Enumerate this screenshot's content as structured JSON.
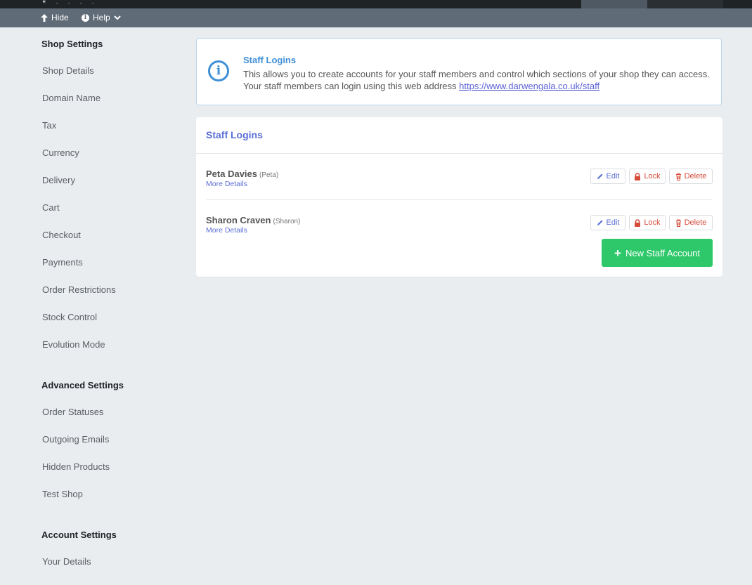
{
  "topbar": {
    "logo": "ꟸ ∙ ∙ ∙ ∙"
  },
  "subbar": {
    "hide_label": "Hide",
    "help_label": "Help"
  },
  "sidebar": {
    "shop_settings": {
      "heading": "Shop Settings",
      "items": [
        "Shop Details",
        "Domain Name",
        "Tax",
        "Currency",
        "Delivery",
        "Cart",
        "Checkout",
        "Payments",
        "Order Restrictions",
        "Stock Control",
        "Evolution Mode"
      ]
    },
    "advanced_settings": {
      "heading": "Advanced Settings",
      "items": [
        "Order Statuses",
        "Outgoing Emails",
        "Hidden Products",
        "Test Shop"
      ]
    },
    "account_settings": {
      "heading": "Account Settings",
      "items": [
        "Your Details"
      ]
    }
  },
  "info": {
    "title": "Staff Logins",
    "text": "This allows you to create accounts for your staff members and control which sections of your shop they can access. Your staff members can login using this web address",
    "link": "https://www.darwengala.co.uk/staff"
  },
  "panel": {
    "title": "Staff Logins",
    "staff": [
      {
        "name": "Peta Davies",
        "username": "(Peta)",
        "more": "More Details"
      },
      {
        "name": "Sharon Craven",
        "username": "(Sharon)",
        "more": "More Details"
      }
    ],
    "buttons": {
      "edit": "Edit",
      "lock": "Lock",
      "delete": "Delete"
    },
    "new_account": "New Staff Account"
  },
  "colors": {
    "accent": "#5a6fd6",
    "info_blue": "#3f8fd6",
    "danger": "#d64a3a",
    "success": "#2ec86a"
  }
}
